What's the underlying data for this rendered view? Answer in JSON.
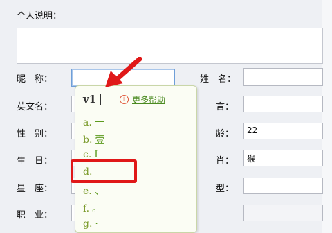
{
  "form": {
    "personal_desc_label": "个人说明：",
    "nickname_label": "昵　称：",
    "english_name_label": "英文名：",
    "gender_label": "性　别：",
    "birthday_label": "生　日：",
    "constellation_label": "星　座：",
    "job_label": "职　业：",
    "surname_label": "姓　名：",
    "motto_label": "言：",
    "age_label": "龄：",
    "age_value": "22",
    "zodiac_label": "肖：",
    "zodiac_value": "猴",
    "blood_label": "型："
  },
  "ime": {
    "composition": "v1",
    "help_text": "更多帮助",
    "candidates": [
      {
        "key": "a.",
        "value": "一"
      },
      {
        "key": "b.",
        "value": "壹"
      },
      {
        "key": "c.",
        "value": "I"
      },
      {
        "key": "d.",
        "value": ""
      },
      {
        "key": "e.",
        "value": "、"
      },
      {
        "key": "f.",
        "value": "。"
      },
      {
        "key": "g.",
        "value": "·"
      }
    ]
  },
  "colors": {
    "highlight_box": "#e01818",
    "arrow": "#e01818",
    "candidate_text": "#5c9a1e"
  }
}
